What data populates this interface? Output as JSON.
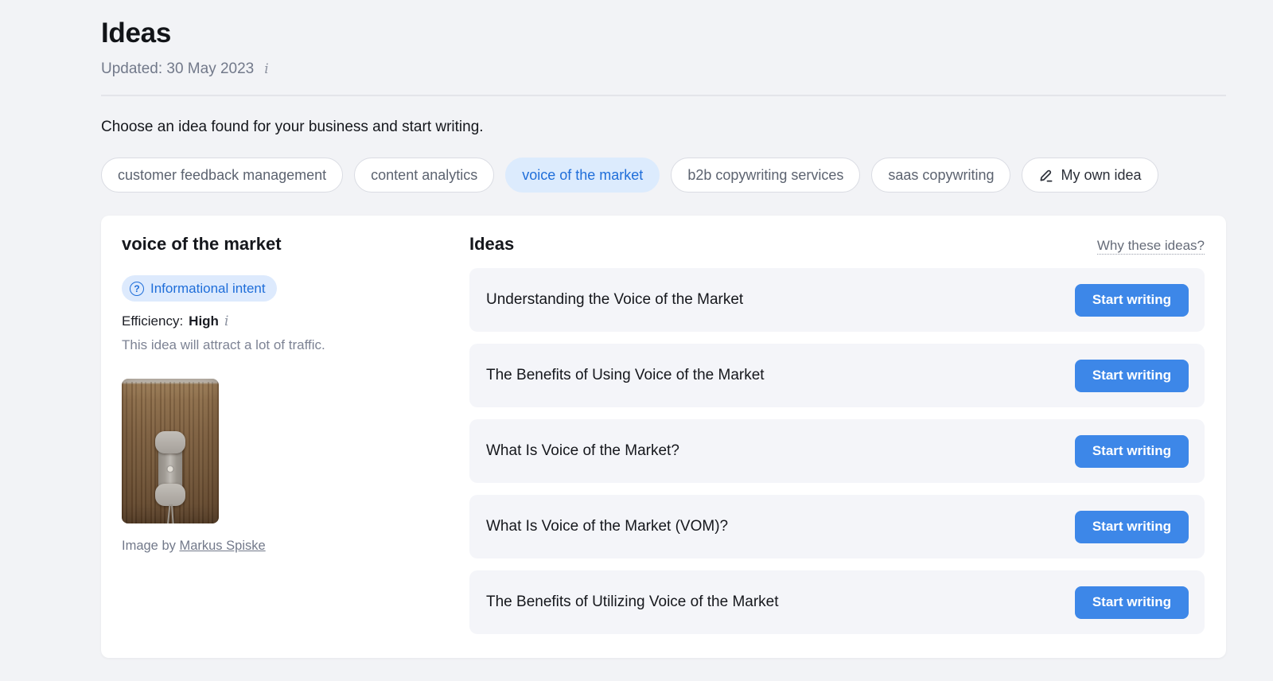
{
  "header": {
    "title": "Ideas",
    "updated": "Updated: 30 May 2023",
    "subtitle": "Choose an idea found for your business and start writing."
  },
  "filters": {
    "items": [
      {
        "label": "customer feedback management",
        "selected": false
      },
      {
        "label": "content analytics",
        "selected": false
      },
      {
        "label": "voice of the market",
        "selected": true
      },
      {
        "label": "b2b copywriting services",
        "selected": false
      },
      {
        "label": "saas copywriting",
        "selected": false
      },
      {
        "label": "My own idea",
        "selected": false,
        "icon": "pencil-icon"
      }
    ]
  },
  "detail": {
    "title": "voice of the market",
    "intent_badge": "Informational intent",
    "intent_icon": "question-circle-icon",
    "efficiency_label": "Efficiency:",
    "efficiency_value": "High",
    "description": "This idea will attract a lot of traffic.",
    "image_credit_prefix": "Image by",
    "image_credit_link": "Markus Spiske"
  },
  "ideas": {
    "title": "Ideas",
    "why_link": "Why these ideas?",
    "start_button_label": "Start writing",
    "items": [
      "Understanding the Voice of the Market",
      "The Benefits of Using Voice of the Market",
      "What Is Voice of the Market?",
      "What Is Voice of the Market (VOM)?",
      "The Benefits of Utilizing Voice of the Market"
    ]
  },
  "colors": {
    "accent_blue": "#3d87e8",
    "selected_pill_bg": "#dcebfd",
    "selected_pill_text": "#1f6ed9",
    "badge_bg": "#ddeafd",
    "row_bg": "#f4f5f9",
    "page_bg": "#f2f3f6"
  }
}
